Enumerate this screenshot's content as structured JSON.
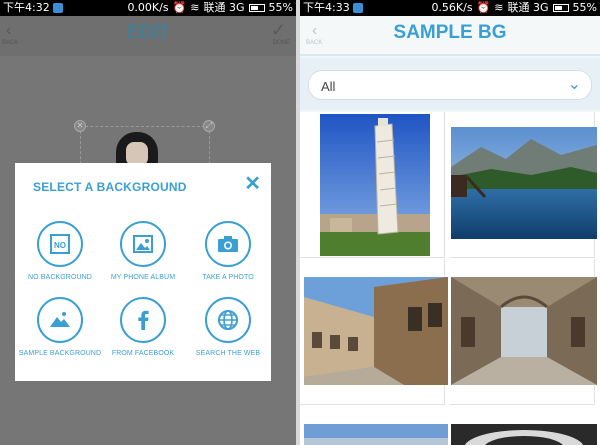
{
  "status_left": {
    "time": "下午4:32",
    "rate": "0.00K/s",
    "carrier": "联通 3G",
    "battery": "55%"
  },
  "status_right": {
    "time": "下午4:33",
    "rate": "0.56K/s",
    "carrier": "联通 3G",
    "battery": "55%"
  },
  "edit_screen": {
    "title": "EDIT",
    "back_label": "BACK",
    "done_label": "DONE",
    "modal": {
      "title": "SELECT A BACKGROUND",
      "options": [
        {
          "label": "NO BACKGROUND",
          "icon": "no-background-icon"
        },
        {
          "label": "MY PHONE ALBUM",
          "icon": "image-icon"
        },
        {
          "label": "TAKE A PHOTO",
          "icon": "camera-icon"
        },
        {
          "label": "SAMPLE BACKGROUND",
          "icon": "landscape-icon"
        },
        {
          "label": "FROM FACEBOOK",
          "icon": "facebook-icon"
        },
        {
          "label": "SEARCH THE WEB",
          "icon": "globe-icon"
        }
      ]
    }
  },
  "sample_screen": {
    "title": "SAMPLE BG",
    "back_label": "BACK",
    "filter": {
      "selected": "All"
    },
    "thumbnails": [
      "leaning-tower",
      "lake-mountains",
      "street-buildings",
      "arcade-gallery",
      "more-1",
      "more-2"
    ]
  }
}
